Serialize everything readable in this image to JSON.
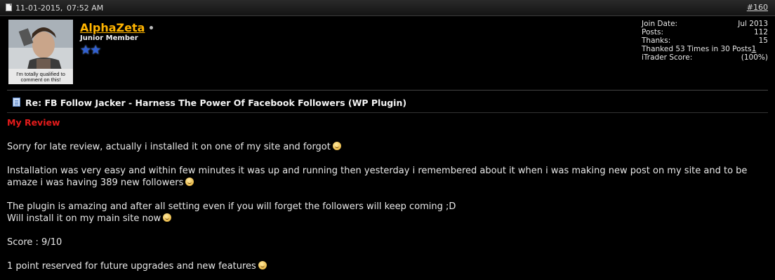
{
  "header": {
    "date": "11-01-2015,",
    "time": "07:52 AM",
    "post_number": "#160"
  },
  "user": {
    "name": "AlphaZeta",
    "title": "Junior Member",
    "avatar_caption": "I'm totally qualified to comment on this!",
    "stars": 2
  },
  "stats": {
    "join_date_label": "Join Date:",
    "join_date_value": "Jul 2013",
    "posts_label": "Posts:",
    "posts_value": "112",
    "thanks_label": "Thanks:",
    "thanks_value": "15",
    "thanked_text": "Thanked 53 Times in 30 Posts",
    "thanked_link": "1",
    "itrader_label": "iTrader Score:",
    "itrader_value": "(100%)"
  },
  "post": {
    "title": "Re: FB Follow Jacker - Harness The Power Of Facebook Followers (WP Plugin)",
    "heading": "My Review",
    "p1": "Sorry for late review, actually i installed it on one of my site and forgot",
    "p2a": "Installation was very easy and within few minutes it was up and running then yesterday i remembered about it when i was making new post on my site and to be",
    "p2b": "amaze i was having 389 new followers",
    "p3a": "The plugin is amazing and after all setting even if you will forget the followers will keep coming ;D",
    "p3b": "Will install it on my main site now",
    "p4": "Score : 9/10",
    "p5": "1 point reserved for future upgrades and new features"
  },
  "colors": {
    "username": "#ffb400",
    "heading": "#e61b1b",
    "background": "#000000"
  }
}
